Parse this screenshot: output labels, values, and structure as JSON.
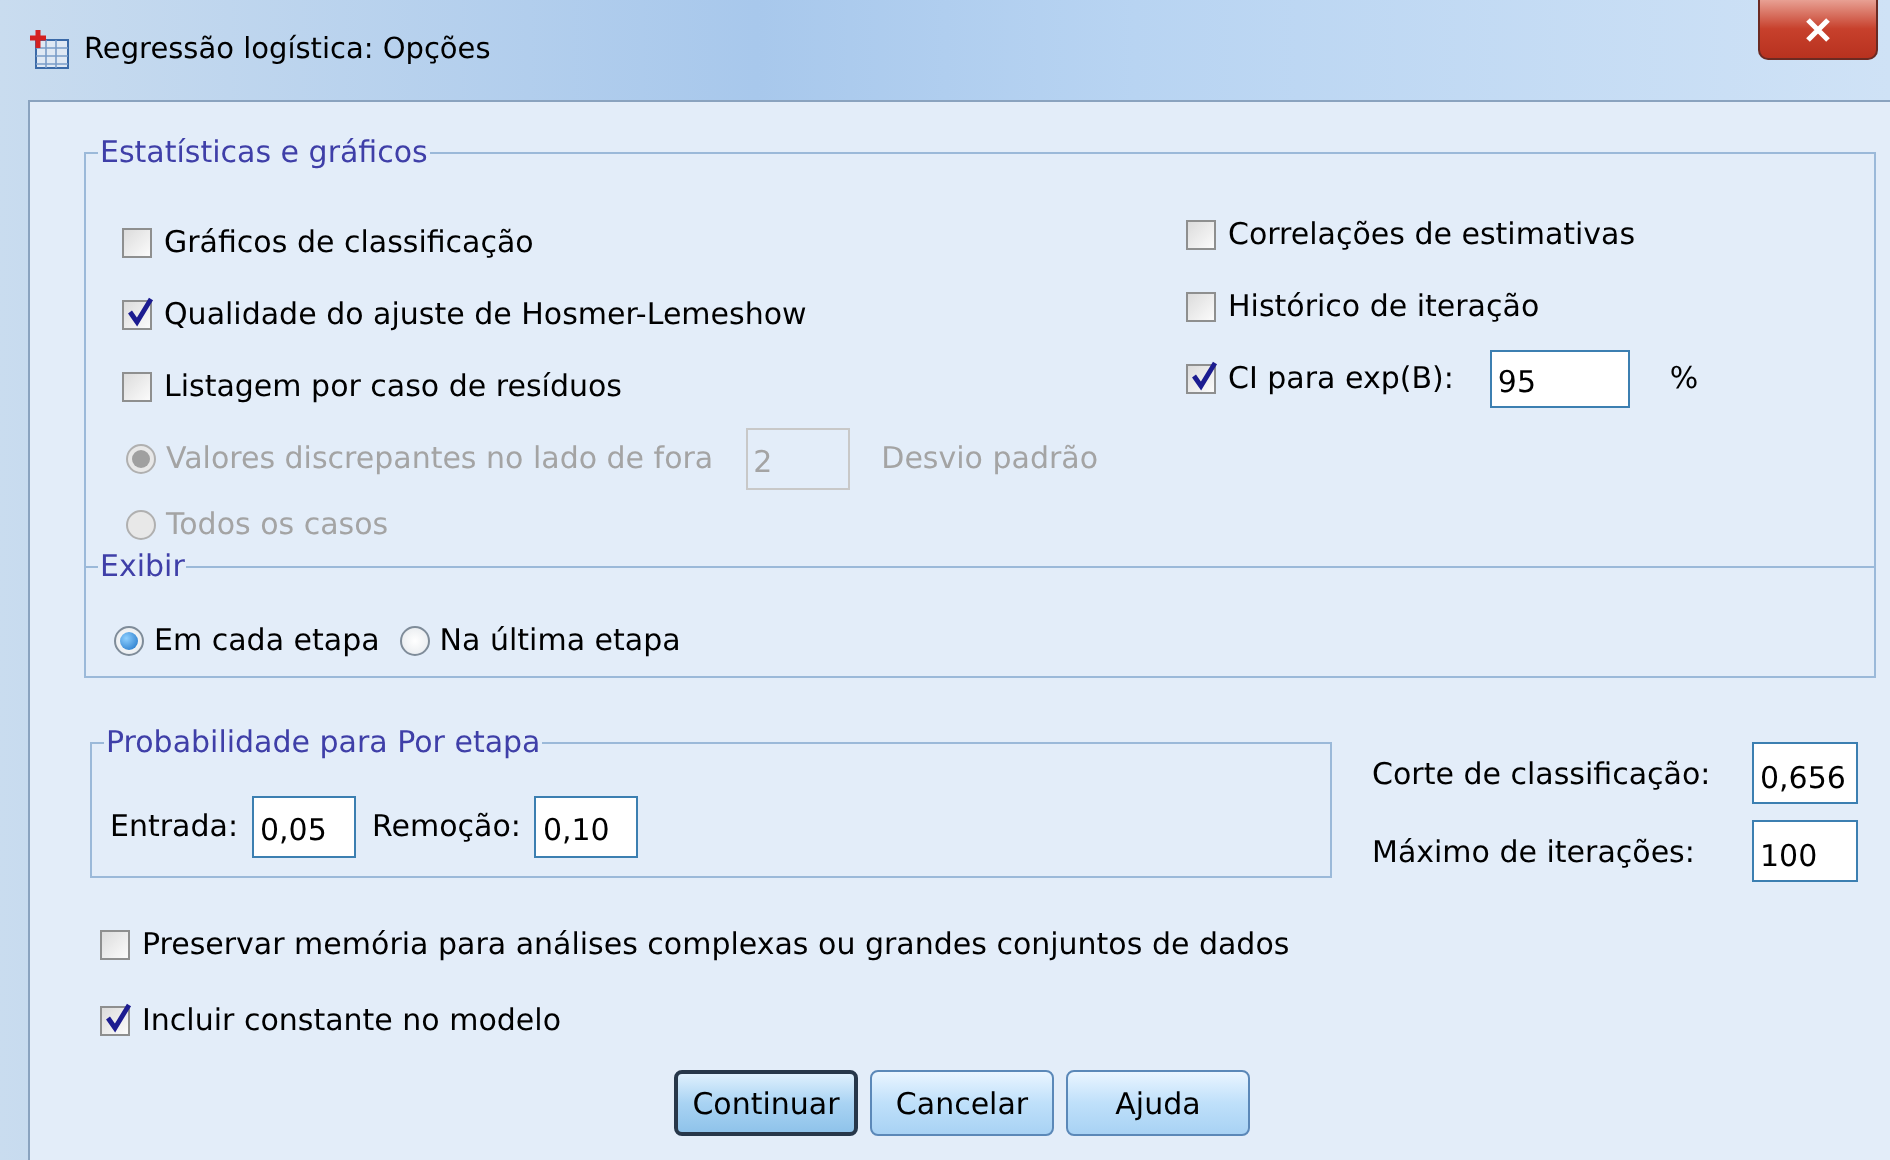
{
  "window": {
    "title": "Regressão logística: Opções"
  },
  "statistics": {
    "title": "Estatísticas e gráficos",
    "checkboxes_left": [
      {
        "label": "Gráficos de classificação",
        "checked": false
      },
      {
        "label": "Qualidade do ajuste de Hosmer-Lemeshow",
        "checked": true
      },
      {
        "label": "Listagem por caso de resíduos",
        "checked": false
      }
    ],
    "residual_options": [
      {
        "label": "Valores discrepantes no lado de fora",
        "selected": true,
        "disabled": true,
        "value": "2",
        "unit": "Desvio padrão"
      },
      {
        "label": "Todos os casos",
        "selected": false,
        "disabled": true
      }
    ],
    "checkboxes_right": [
      {
        "label": "Correlações de estimativas",
        "checked": false
      },
      {
        "label": "Histórico de iteração",
        "checked": false
      },
      {
        "label": "CI para exp(B):",
        "checked": true,
        "value": "95",
        "unit": "%"
      }
    ]
  },
  "display": {
    "title": "Exibir",
    "options": [
      {
        "label": "Em cada etapa",
        "selected": true
      },
      {
        "label": "Na última etapa",
        "selected": false
      }
    ]
  },
  "stepwise": {
    "title": "Probabilidade para Por etapa",
    "fields": [
      {
        "label": "Entrada:",
        "value": "0,05"
      },
      {
        "label": "Remoção:",
        "value": "0,10"
      }
    ]
  },
  "right_fields": [
    {
      "label": "Corte de classificação:",
      "value": "0,656"
    },
    {
      "label": "Máximo de iterações:",
      "value": "100"
    }
  ],
  "bottom_checkboxes": [
    {
      "label": "Preservar memória para análises complexas ou grandes conjuntos de dados",
      "checked": false
    },
    {
      "label": "Incluir constante no modelo",
      "checked": true
    }
  ],
  "buttons": [
    {
      "label": "Continuar",
      "default": true
    },
    {
      "label": "Cancelar",
      "default": false
    },
    {
      "label": "Ajuda",
      "default": false
    }
  ]
}
